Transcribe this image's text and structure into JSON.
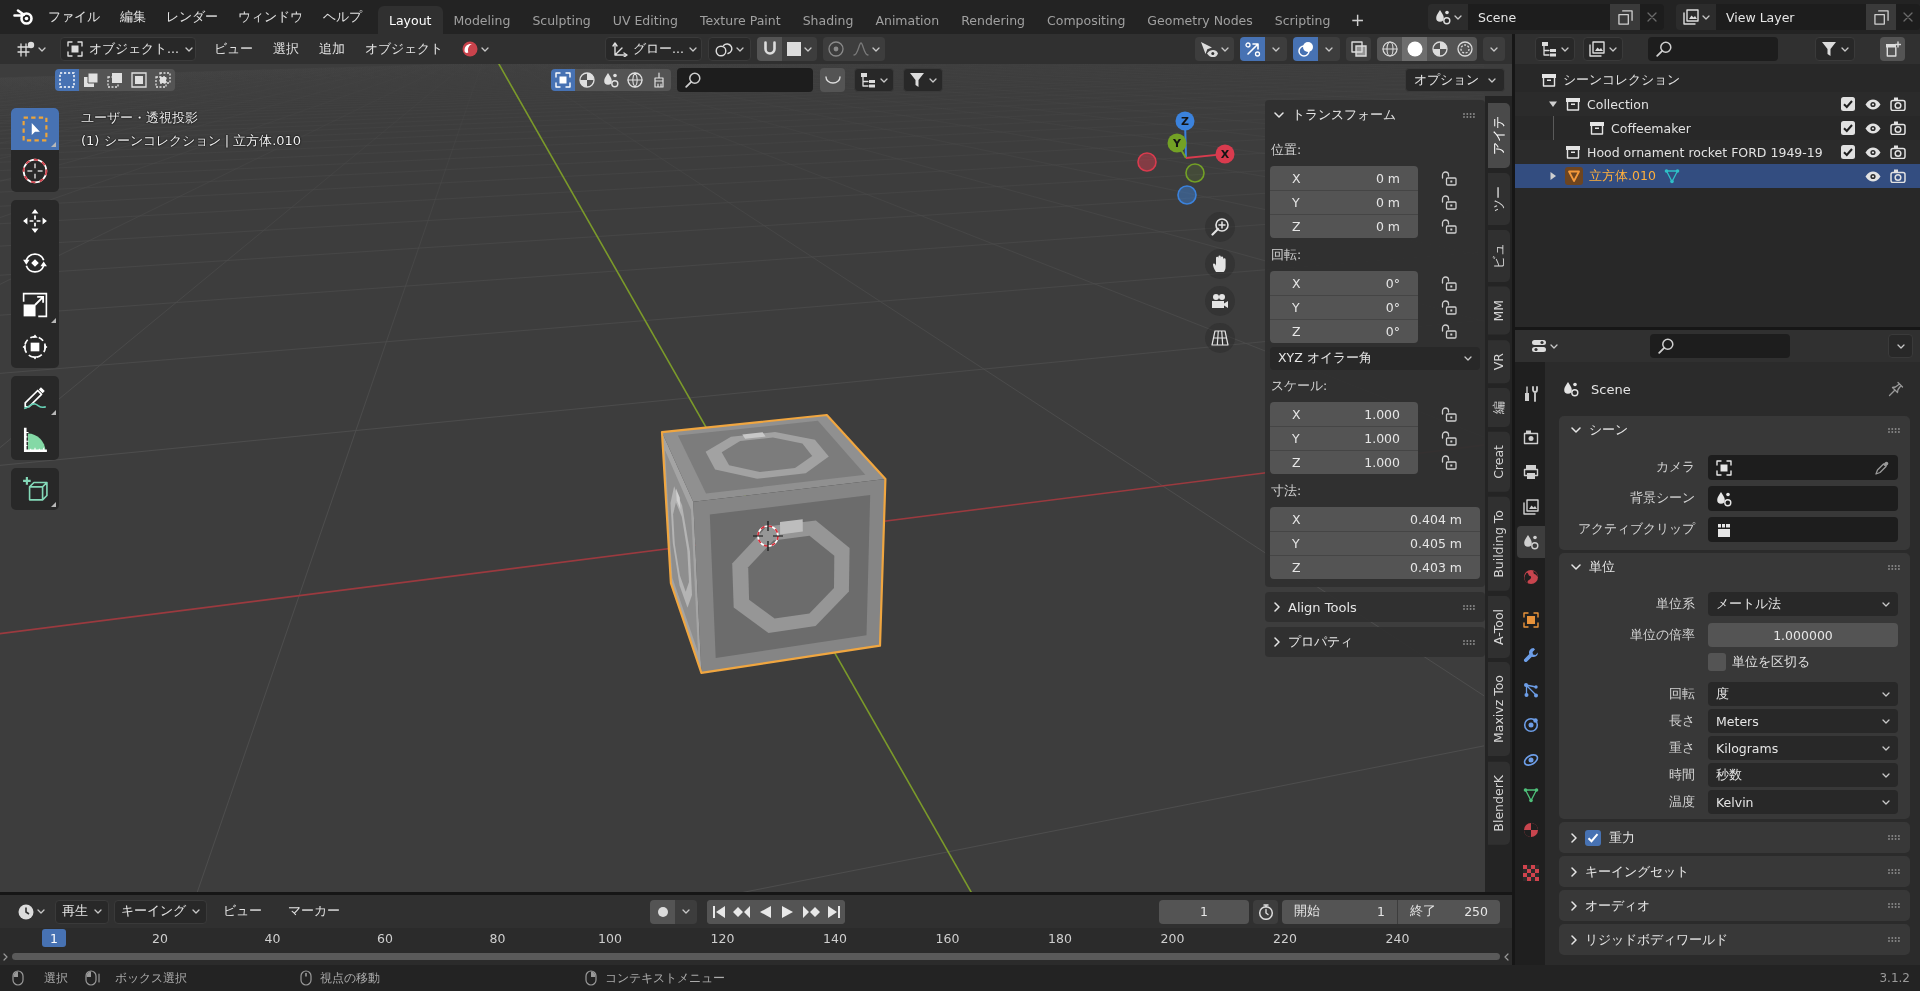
{
  "top_bar": {
    "menus": [
      "ファイル",
      "編集",
      "レンダー",
      "ウィンドウ",
      "ヘルプ"
    ],
    "workspaces": [
      {
        "label": "Layout",
        "selected": true
      },
      {
        "label": "Modeling",
        "selected": false
      },
      {
        "label": "Sculpting",
        "selected": false
      },
      {
        "label": "UV Editing",
        "selected": false
      },
      {
        "label": "Texture Paint",
        "selected": false
      },
      {
        "label": "Shading",
        "selected": false
      },
      {
        "label": "Animation",
        "selected": false
      },
      {
        "label": "Rendering",
        "selected": false
      },
      {
        "label": "Compositing",
        "selected": false
      },
      {
        "label": "Geometry Nodes",
        "selected": false
      },
      {
        "label": "Scripting",
        "selected": false
      }
    ],
    "add_workspace": "+",
    "scene": "Scene",
    "view_layer": "View Layer"
  },
  "viewport": {
    "header": {
      "mode": "オブジェクト...",
      "menus": [
        "ビュー",
        "選択",
        "追加",
        "オブジェクト"
      ],
      "orientation": "グロー...",
      "toggles": [
        {
          "kind": "gizmo",
          "on": true
        },
        {
          "kind": "overlay",
          "on": true
        },
        {
          "kind": "xray",
          "on": false
        }
      ],
      "shading": [
        {
          "kind": "wireframe",
          "selected": false
        },
        {
          "kind": "solid",
          "selected": true
        },
        {
          "kind": "material",
          "selected": false
        },
        {
          "kind": "rendered",
          "selected": false
        }
      ],
      "select_modes": [
        {
          "kind": "set",
          "selected": true
        },
        {
          "kind": "extend",
          "selected": false
        },
        {
          "kind": "subtract",
          "selected": false
        },
        {
          "kind": "invert",
          "selected": false
        },
        {
          "kind": "intersect",
          "selected": false
        }
      ],
      "filters": [
        {
          "kind": "object",
          "selected": true
        },
        {
          "kind": "material",
          "selected": false
        },
        {
          "kind": "scene",
          "selected": false
        },
        {
          "kind": "world",
          "selected": false
        },
        {
          "kind": "brush",
          "selected": false
        }
      ],
      "options": "オプション"
    },
    "view_name": "ユーザー・透視投影",
    "object_info": "(1) シーンコレクション | 立方体.010",
    "tool_groups": [
      {
        "tools": [
          {
            "kind": "select",
            "selected": true
          },
          {
            "kind": "cursor",
            "selected": false
          }
        ]
      },
      {
        "tools": [
          {
            "kind": "move",
            "selected": false
          },
          {
            "kind": "rotate",
            "selected": false
          },
          {
            "kind": "scale",
            "selected": false
          },
          {
            "kind": "transform",
            "selected": false
          }
        ]
      },
      {
        "tools": [
          {
            "kind": "annotate",
            "selected": false
          },
          {
            "kind": "measure",
            "selected": false
          }
        ]
      },
      {
        "tools": [
          {
            "kind": "add_cube",
            "selected": false
          }
        ]
      }
    ],
    "gizmo": [
      {
        "label": "Z",
        "color": "#3b82dc"
      },
      {
        "label": "Y",
        "color": "#73a125"
      },
      {
        "label": "X",
        "color": "#d93b4e"
      }
    ]
  },
  "sidebar": {
    "panels": [
      {
        "title": "トランスフォーム",
        "expanded": true,
        "rows": [
          {
            "kind": "vector",
            "label": "位置:",
            "fields": [
              {
                "axis": "X",
                "value": "0 m",
                "locked": false
              },
              {
                "axis": "Y",
                "value": "0 m",
                "locked": false
              },
              {
                "axis": "Z",
                "value": "0 m",
                "locked": false
              }
            ]
          },
          {
            "kind": "vector",
            "label": "回転:",
            "fields": [
              {
                "axis": "X",
                "value": "0°",
                "locked": false
              },
              {
                "axis": "Y",
                "value": "0°",
                "locked": false
              },
              {
                "axis": "Z",
                "value": "0°",
                "locked": false
              }
            ]
          },
          {
            "kind": "dropdown",
            "value": "XYZ オイラー角"
          },
          {
            "kind": "vector",
            "label": "スケール:",
            "fields": [
              {
                "axis": "X",
                "value": "1.000",
                "locked": false
              },
              {
                "axis": "Y",
                "value": "1.000",
                "locked": false
              },
              {
                "axis": "Z",
                "value": "1.000",
                "locked": false
              }
            ]
          },
          {
            "kind": "vector",
            "label": "寸法:",
            "fields": [
              {
                "axis": "X",
                "value": "0.404 m"
              },
              {
                "axis": "Y",
                "value": "0.405 m"
              },
              {
                "axis": "Z",
                "value": "0.403 m"
              }
            ]
          }
        ]
      },
      {
        "title": "Align Tools",
        "expanded": false
      },
      {
        "title": "プロパティ",
        "expanded": false
      }
    ],
    "tabs": [
      {
        "label": "アイテ",
        "selected": true
      },
      {
        "label": "ツー",
        "selected": false
      },
      {
        "label": "ビュ",
        "selected": false
      },
      {
        "label": "MM",
        "selected": false
      },
      {
        "label": "VR",
        "selected": false
      },
      {
        "label": "編",
        "selected": false
      },
      {
        "label": "Creat",
        "selected": false
      },
      {
        "label": "Building To",
        "selected": false
      },
      {
        "label": "A-Tool",
        "selected": false
      },
      {
        "label": "Maxivz Too",
        "selected": false
      },
      {
        "label": "BlenderK",
        "selected": false
      }
    ]
  },
  "timeline": {
    "menus": [
      {
        "kind": "dropdown",
        "label": "再生"
      },
      {
        "kind": "dropdown",
        "label": "キーイング"
      },
      {
        "kind": "menu",
        "label": "ビュー"
      },
      {
        "kind": "menu",
        "label": "マーカー"
      }
    ],
    "current_frame": "1",
    "start": {
      "label": "開始",
      "value": "1"
    },
    "end": {
      "label": "終了",
      "value": "250"
    },
    "playhead": "1",
    "ruler": [
      "20",
      "40",
      "60",
      "80",
      "100",
      "120",
      "140",
      "160",
      "180",
      "200",
      "220",
      "240"
    ]
  },
  "outliner": {
    "tree": [
      {
        "kind": "scene_collection",
        "label": "シーンコレクション",
        "selected": false,
        "children": [
          {
            "kind": "collection",
            "label": "Collection",
            "selected": false,
            "expanded": true,
            "checked": true,
            "children": [
              {
                "kind": "collection",
                "label": "Coffeemaker",
                "selected": false,
                "checked": true
              }
            ]
          },
          {
            "kind": "collection",
            "label": "Hood ornament rocket FORD 1949-19",
            "selected": false,
            "checked": true
          },
          {
            "kind": "object",
            "label": "立方体.010",
            "selected": true,
            "expanded": false
          }
        ]
      }
    ]
  },
  "properties": {
    "tab_groups": [
      {
        "tabs": [
          {
            "kind": "tool",
            "selected": false
          }
        ]
      },
      {
        "tabs": [
          {
            "kind": "render",
            "selected": false
          },
          {
            "kind": "output",
            "selected": false
          },
          {
            "kind": "view_layer",
            "selected": false
          },
          {
            "kind": "scene",
            "selected": true
          },
          {
            "kind": "world",
            "selected": false
          }
        ]
      },
      {
        "tabs": [
          {
            "kind": "object",
            "selected": false
          },
          {
            "kind": "modifiers",
            "selected": false
          },
          {
            "kind": "particles",
            "selected": false
          },
          {
            "kind": "physics",
            "selected": false
          },
          {
            "kind": "constraints",
            "selected": false
          },
          {
            "kind": "data",
            "selected": false
          },
          {
            "kind": "material",
            "selected": false
          }
        ]
      },
      {
        "tabs": [
          {
            "kind": "texture",
            "selected": false
          }
        ]
      }
    ],
    "context": "Scene",
    "panels": [
      {
        "title": "シーン",
        "expanded": true,
        "rows": [
          {
            "kind": "camera",
            "label": "カメラ"
          },
          {
            "kind": "scene",
            "label": "背景シーン"
          },
          {
            "kind": "clip",
            "label": "アクティブクリップ"
          }
        ]
      },
      {
        "title": "単位",
        "expanded": true,
        "rows": [
          {
            "kind": "dropdown",
            "label": "単位系",
            "value": "メートル法"
          },
          {
            "kind": "number",
            "label": "単位の倍率",
            "value": "1.000000"
          },
          {
            "kind": "checkbox",
            "label": "単位を区切る",
            "checked": false
          },
          {
            "kind": "dropdown",
            "label": "回転",
            "value": "度"
          },
          {
            "kind": "dropdown",
            "label": "長さ",
            "value": "Meters"
          },
          {
            "kind": "dropdown",
            "label": "重さ",
            "value": "Kilograms"
          },
          {
            "kind": "dropdown",
            "label": "時間",
            "value": "秒数"
          },
          {
            "kind": "dropdown",
            "label": "温度",
            "value": "Kelvin"
          }
        ]
      },
      {
        "title": "重力",
        "expanded": false,
        "checked": true
      },
      {
        "title": "キーイングセット",
        "expanded": false
      },
      {
        "title": "オーディオ",
        "expanded": false
      },
      {
        "title": "リジッドボディワールド",
        "expanded": false
      }
    ]
  },
  "status_bar": {
    "hints": [
      {
        "kind": "lmb",
        "label": "選択"
      },
      {
        "kind": "lmb_drag",
        "label": "ボックス選択"
      },
      {
        "kind": "mmb",
        "label": "視点の移動"
      },
      {
        "kind": "rmb",
        "label": "コンテキストメニュー"
      }
    ],
    "version": "3.1.2"
  }
}
